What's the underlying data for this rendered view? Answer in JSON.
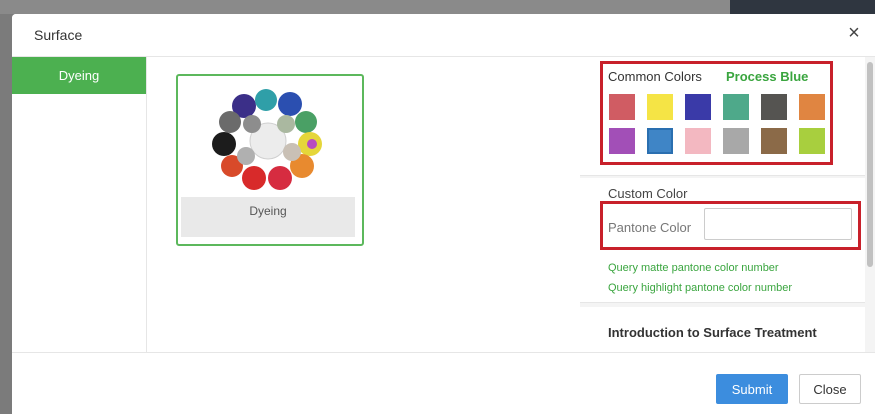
{
  "modal": {
    "title": "Surface",
    "close_icon": "close-icon"
  },
  "tabs": [
    {
      "label": "Dyeing",
      "active": true
    }
  ],
  "preview": {
    "card_label": "Dyeing",
    "image": "dyed-parts-image"
  },
  "common_colors": {
    "label": "Common Colors",
    "selected_name": "Process Blue",
    "swatches": [
      {
        "color": "#d05c63"
      },
      {
        "color": "#f5e445"
      },
      {
        "color": "#3a3aa8"
      },
      {
        "color": "#4ea98a"
      },
      {
        "color": "#555451"
      },
      {
        "color": "#e08541"
      },
      {
        "color": "#a24fb7"
      },
      {
        "color": "#3f85c6",
        "selected": true
      },
      {
        "color": "#f3b8c1"
      },
      {
        "color": "#a8a8a8"
      },
      {
        "color": "#8b6a48"
      },
      {
        "color": "#a8cf3e"
      }
    ]
  },
  "custom_color": {
    "title": "Custom Color",
    "pantone_label": "Pantone Color",
    "pantone_value": "",
    "query_matte": "Query matte pantone color number",
    "query_highlight": "Query highlight pantone color number"
  },
  "intro": {
    "title": "Introduction to Surface Treatment"
  },
  "footer": {
    "submit_label": "Submit",
    "close_label": "Close"
  },
  "colors": {
    "accent_green": "#4cb050",
    "link_green": "#3aa53f",
    "submit_blue": "#3c8dde",
    "highlight_red": "#c8202a"
  }
}
